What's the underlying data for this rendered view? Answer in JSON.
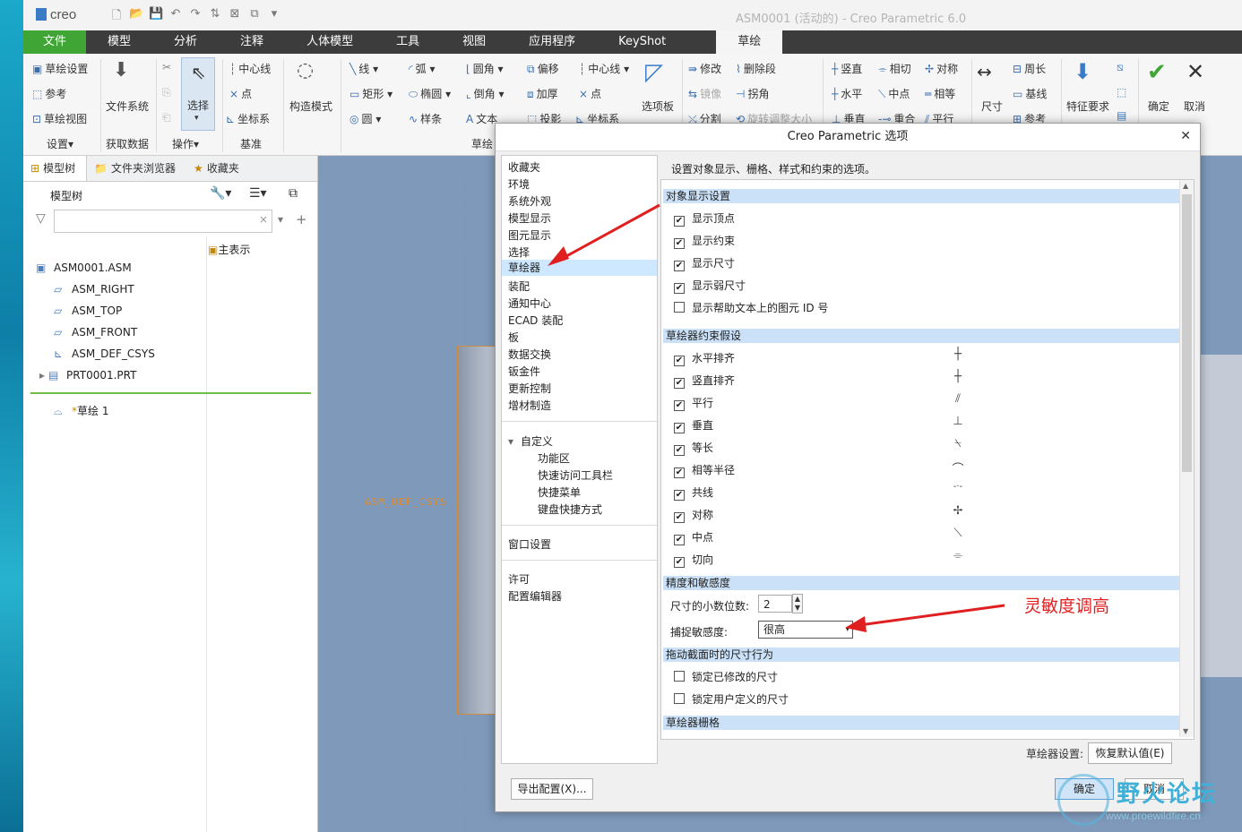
{
  "window": {
    "title": "ASM0001 (活动的) - Creo Parametric 6.0",
    "logo": "creo"
  },
  "ribbon_tabs": [
    "文件",
    "模型",
    "分析",
    "注释",
    "人体模型",
    "工具",
    "视图",
    "应用程序",
    "KeyShot",
    "草绘"
  ],
  "ribbon": {
    "setup": [
      "草绘设置",
      "参考",
      "草绘视图"
    ],
    "setup_group": "设置▾",
    "get_data": "文件系统",
    "get_data_group": "获取数据",
    "select": "选择",
    "ops_group": "操作▾",
    "datum": [
      "中心线",
      "点",
      "坐标系"
    ],
    "datum_group": "基准",
    "construct": "构造模式",
    "sketch_col1": [
      "线",
      "矩形",
      "圆"
    ],
    "sketch_col2": [
      "弧",
      "椭圆",
      "样条"
    ],
    "sketch_col3": [
      "圆角",
      "倒角",
      "文本"
    ],
    "sketch_col4": [
      "偏移",
      "加厚",
      "投影"
    ],
    "sketch_col5": [
      "中心线",
      "点",
      "坐标系"
    ],
    "palette": "选项板",
    "sketch_group": "草绘",
    "edit_col1": [
      "修改",
      "镜像",
      "分割"
    ],
    "edit_col2": [
      "删除段",
      "拐角",
      "旋转调整大小"
    ],
    "constrain_col1": [
      "竖直",
      "水平",
      "垂直"
    ],
    "constrain_col2": [
      "相切",
      "中点",
      "重合"
    ],
    "constrain_col3": [
      "对称",
      "相等",
      "平行"
    ],
    "dimension": "尺寸",
    "dim_col": [
      "周长",
      "基线",
      "参考"
    ],
    "feature_req": "特征要求",
    "ok": "确定",
    "cancel": "取消"
  },
  "left_panel": {
    "tabs": [
      "模型树",
      "文件夹浏览器",
      "收藏夹"
    ],
    "tree_header": "模型树",
    "column_header": "主表示",
    "nodes": [
      "ASM0001.ASM",
      "ASM_RIGHT",
      "ASM_TOP",
      "ASM_FRONT",
      "ASM_DEF_CSYS",
      "PRT0001.PRT"
    ],
    "insert_node": "草绘 1"
  },
  "graphics": {
    "csys_label": "ASM_DEF_CSYS"
  },
  "dialog": {
    "title": "Creo Parametric 选项",
    "description": "设置对象显示、栅格、样式和约束的选项。",
    "categories": [
      "收藏夹",
      "环境",
      "系统外观",
      "模型显示",
      "图元显示",
      "选择",
      "草绘器",
      "装配",
      "通知中心",
      "ECAD 装配",
      "板",
      "数据交换",
      "钣金件",
      "更新控制",
      "增材制造"
    ],
    "selected_category": "草绘器",
    "customize": {
      "header": "自定义",
      "items": [
        "功能区",
        "快速访问工具栏",
        "快捷菜单",
        "键盘快捷方式"
      ]
    },
    "window_settings": "窗口设置",
    "bottom_cats": [
      "许可",
      "配置编辑器"
    ],
    "sections": {
      "display": "对象显示设置",
      "constraints": "草绘器约束假设",
      "precision": "精度和敏感度",
      "drag": "拖动截面时的尺寸行为",
      "grid": "草绘器栅格"
    },
    "display_opts": [
      {
        "label": "显示顶点",
        "checked": true
      },
      {
        "label": "显示约束",
        "checked": true
      },
      {
        "label": "显示尺寸",
        "checked": true
      },
      {
        "label": "显示弱尺寸",
        "checked": true
      },
      {
        "label": "显示帮助文本上的图元 ID 号",
        "checked": false
      }
    ],
    "constraint_opts": [
      {
        "label": "水平排齐",
        "checked": true,
        "icon": "plus-sign-icon",
        "glyph": "┼"
      },
      {
        "label": "竖直排齐",
        "checked": true,
        "icon": "plus-sign-icon",
        "glyph": "┼"
      },
      {
        "label": "平行",
        "checked": true,
        "icon": "parallel-icon",
        "glyph": "⫽"
      },
      {
        "label": "垂直",
        "checked": true,
        "icon": "perpendicular-icon",
        "glyph": "⊥"
      },
      {
        "label": "等长",
        "checked": true,
        "icon": "equal-length-icon",
        "glyph": "⍀"
      },
      {
        "label": "相等半径",
        "checked": true,
        "icon": "equal-radius-icon",
        "glyph": "⌒"
      },
      {
        "label": "共线",
        "checked": true,
        "icon": "collinear-icon",
        "glyph": "-·-"
      },
      {
        "label": "对称",
        "checked": true,
        "icon": "symmetric-icon",
        "glyph": "✢"
      },
      {
        "label": "中点",
        "checked": true,
        "icon": "midpoint-icon",
        "glyph": "⟍"
      },
      {
        "label": "切向",
        "checked": true,
        "icon": "tangent-icon",
        "glyph": "⌯"
      }
    ],
    "decimal_label": "尺寸的小数位数:",
    "decimal_value": "2",
    "snap_label": "捕捉敏感度:",
    "snap_value": "很高",
    "drag_opts": [
      {
        "label": "锁定已修改的尺寸",
        "checked": false
      },
      {
        "label": "锁定用户定义的尺寸",
        "checked": false
      }
    ],
    "sketcher_settings_label": "草绘器设置:",
    "restore_default": "恢复默认值(E)",
    "export_config": "导出配置(X)...",
    "ok": "确定",
    "cancel": "取消"
  },
  "annotation": "灵敏度调高",
  "watermark": {
    "title": "野火论坛",
    "url": "www.proewildfire.cn"
  },
  "colors": {
    "file_tab": "#3fa535",
    "selection": "#cde8ff",
    "section": "#cbe1f7",
    "annotation": "#e02020"
  }
}
